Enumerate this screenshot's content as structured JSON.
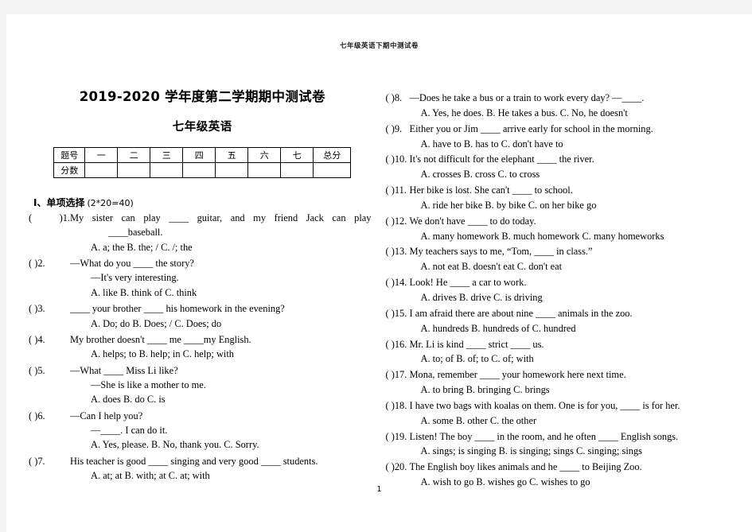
{
  "header": {
    "running_title": "七年级英语下期中测试卷"
  },
  "title": {
    "main": "2019-2020 学年度第二学期期中测试卷",
    "sub": "七年级英语"
  },
  "score_table": {
    "row_labels": [
      "题号",
      "分数"
    ],
    "columns": [
      "一",
      "二",
      "三",
      "四",
      "五",
      "六",
      "七",
      "总分"
    ],
    "values": [
      "",
      "",
      "",
      "",
      "",
      "",
      "",
      ""
    ]
  },
  "section": {
    "number": "I、",
    "name": "单项选择",
    "points": "(2*20=40)"
  },
  "page_number": "1",
  "questions_left": [
    {
      "paren": "(      )1.",
      "lines": [
        "My  sister  can  play  ____  guitar,  and  my  friend  Jack  can  play",
        "____baseball."
      ],
      "options": "A. a; the      B. the; /      C. /; the"
    },
    {
      "paren": "(      )2.",
      "lines": [
        "—What do you  ____  the story?",
        "—It's very interesting."
      ],
      "options": "A. like      B. think of      C. think"
    },
    {
      "paren": "(      )3.",
      "lines": [
        "____  your brother  ____  his homework in the evening?"
      ],
      "options": "A. Do; do      B. Does; /      C. Does; do"
    },
    {
      "paren": "(      )4.",
      "lines": [
        "My brother doesn't  ____  me  ____my English."
      ],
      "options": "A. helps; to      B. help; in      C. help; with"
    },
    {
      "paren": "(      )5.",
      "lines": [
        "—What  ____  Miss Li like?",
        "—She is like a mother to me."
      ],
      "options": "A. does      B. do      C. is"
    },
    {
      "paren": "(      )6.",
      "lines": [
        "—Can I help you?",
        "—____. I can do it."
      ],
      "options": "A. Yes, please.      B. No, thank you.      C. Sorry."
    },
    {
      "paren": "(      )7.",
      "lines": [
        "His teacher is good  ____  singing and very good  ____  students."
      ],
      "options": "A. at; at      B. with; at      C. at; with"
    }
  ],
  "questions_right": [
    {
      "paren": "(     )8.",
      "text": "—Does he take a bus or a train to work every day?      —____.",
      "options": "A. Yes, he does.      B. He takes a bus.      C. No, he doesn't"
    },
    {
      "paren": "(     )9.",
      "text": "Either you or Jim  ____  arrive early for school in the morning.",
      "options": "A. have to      B. has to      C. don't have to"
    },
    {
      "paren": "(     )10.",
      "text": "It's not difficult for the elephant  ____  the river.",
      "options": "A. crosses      B. cross      C. to cross"
    },
    {
      "paren": "(     )11.",
      "text": "Her bike is lost. She can't  ____  to school.",
      "options": "A. ride her bike      B. by bike      C. on her bike go"
    },
    {
      "paren": "(     )12.",
      "text": "We don't have  ____  to do today.",
      "options": "A. many homework      B. much homework      C. many homeworks"
    },
    {
      "paren": "(     )13.",
      "text": "My teachers says to me, “Tom,  ____  in class.”",
      "options": "A. not eat      B. doesn't eat      C. don't eat"
    },
    {
      "paren": "(     )14.",
      "text": "Look! He  ____  a car to work.",
      "options": "A. drives      B. drive      C. is driving"
    },
    {
      "paren": "(     )15.",
      "text": "I am afraid there are about nine  ____  animals in the zoo.",
      "options": "A. hundreds      B. hundreds of      C. hundred"
    },
    {
      "paren": "(     )16.",
      "text": "Mr. Li is kind  ____  strict  ____  us.",
      "options": "A. to; of      B. of; to      C. of; with"
    },
    {
      "paren": "(     )17.",
      "text": "Mona, remember    ____  your homework here next time.",
      "options": "A. to bring      B. bringing      C. brings"
    },
    {
      "paren": "(     )18.",
      "text": "I have two bags with koalas on them. One is for you, ____ is for her.",
      "options": "A. some      B. other      C. the other"
    },
    {
      "paren": "(     )19.",
      "text": "Listen! The boy  ____  in the room, and he often  ____  English songs.",
      "options": "A. sings; is singing      B. is singing; sings      C. singing; sings"
    },
    {
      "paren": "(     )20.",
      "text": "The English boy likes animals and he  ____  to Beijing Zoo.",
      "options": "A. wish to go      B. wishes go      C. wishes to go"
    }
  ]
}
